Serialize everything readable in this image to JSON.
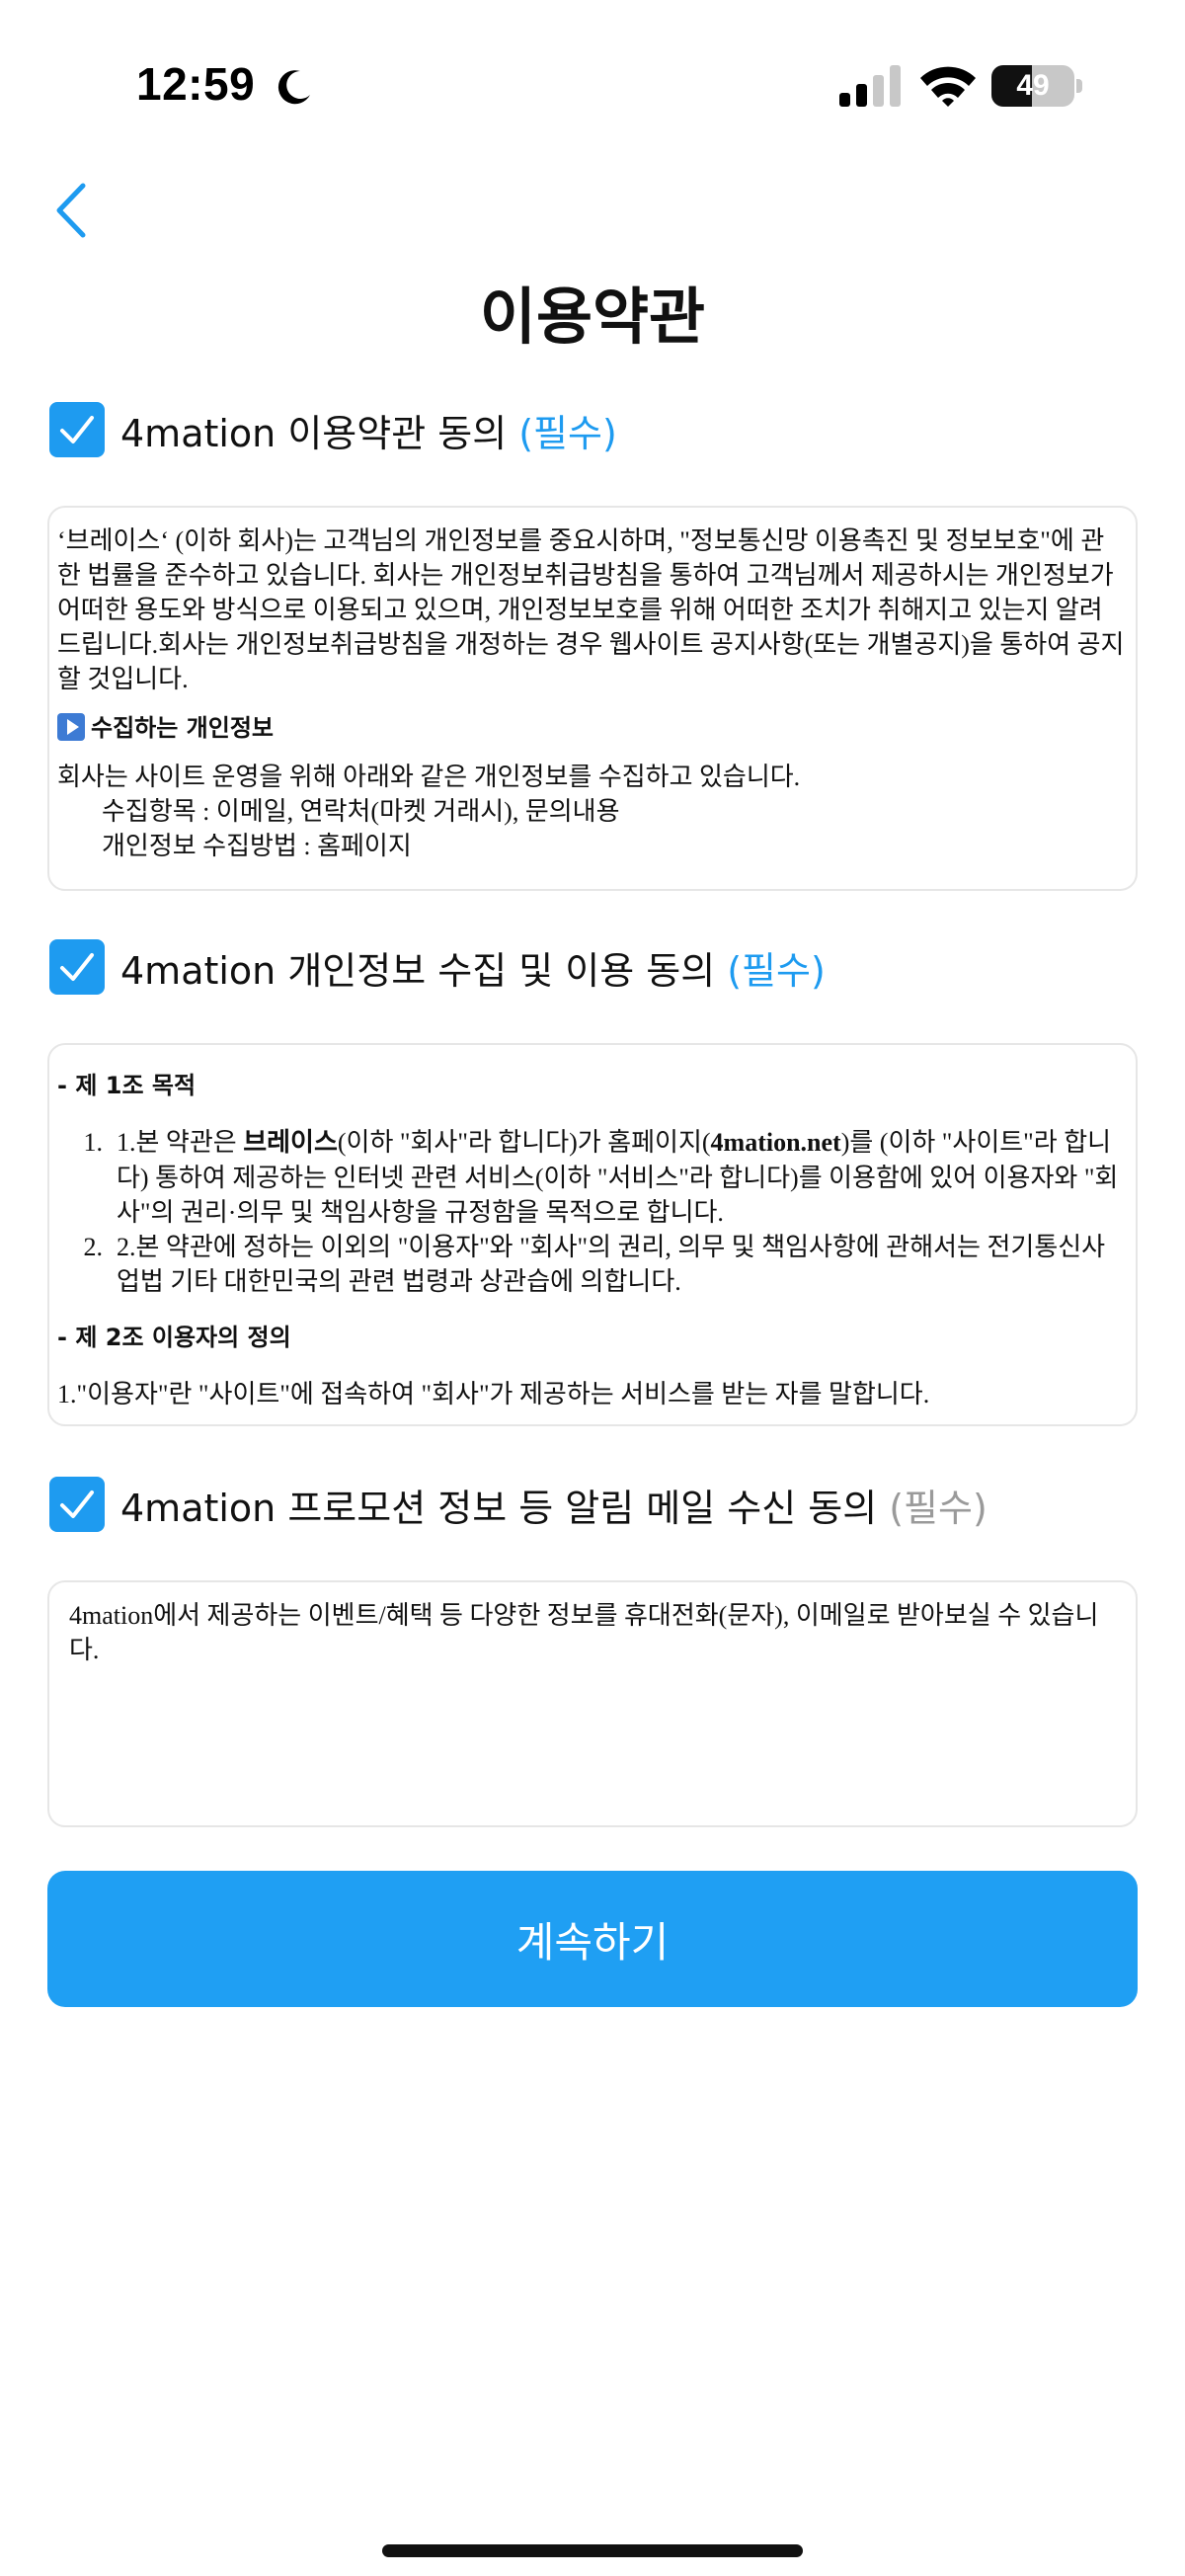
{
  "status_bar": {
    "time": "12:59",
    "battery_level": "49",
    "battery_fraction": 0.49
  },
  "header": {
    "title": "이용약관",
    "back_icon": "chevron-left-icon"
  },
  "colors": {
    "accent": "#1e9bf0",
    "button": "#1f9ff3",
    "required_gray": "#9a9a9a"
  },
  "sections": [
    {
      "checked": true,
      "label": "4mation 이용약관 동의",
      "required": "(필수)",
      "content": {
        "intro": "‘브레이스‘ (이하 회사)는 고객님의 개인정보를 중요시하며, \"정보통신망 이용촉진 및 정보보호\"에 관한 법률을 준수하고 있습니다. 회사는 개인정보취급방침을 통하여 고객님께서 제공하시는 개인정보가 어떠한 용도와 방식으로 이용되고 있으며, 개인정보보호를 위해 어떠한 조치가 취해지고 있는지 알려드립니다.회사는 개인정보취급방침을 개정하는 경우 웹사이트 공지사항(또는 개별공지)을 통하여 공지할 것입니다.",
        "heading": "수집하는 개인정보",
        "heading_icon": "play-button-icon",
        "body": "회사는 사이트 운영을 위해 아래와 같은 개인정보를 수집하고 있습니다.",
        "item1": "수집항목 : 이메일, 연락처(마켓 거래시), 문의내용",
        "item2": "개인정보 수집방법 : 홈페이지"
      }
    },
    {
      "checked": true,
      "label": "4mation 개인정보 수집 및 이용 동의",
      "required": "(필수)",
      "content": {
        "heading1": "- 제 1조 목적",
        "item1_num": "1.",
        "item1_a": "1.본 약관은 ",
        "item1_b": "브레이스",
        "item1_c": "(이하 \"회사\"라 합니다)가 홈페이지(",
        "item1_d": "4mation.net",
        "item1_e": ")를 (이하 \"사이트\"라 합니다) 통하여 제공하는 인터넷 관련 서비스(이하 \"서비스\"라 합니다)를 이용함에 있어 이용자와 \"회사\"의 권리·의무 및 책임사항을 규정함을 목적으로 합니다.",
        "item2_num": "2.",
        "item2": "2.본 약관에 정하는 이외의 \"이용자\"와 \"회사\"의 권리, 의무 및 책임사항에 관해서는 전기통신사업법 기타 대한민국의 관련 법령과 상관습에 의합니다.",
        "heading2": "- 제 2조 이용자의 정의",
        "def1": "1.\"이용자\"란 \"사이트\"에 접속하여 \"회사\"가 제공하는 서비스를 받는 자를 말합니다."
      }
    },
    {
      "checked": true,
      "label": "4mation 프로모션 정보 등 알림 메일 수신 동의",
      "required": "(필수)",
      "content": {
        "body": "4mation에서 제공하는 이벤트/혜택 등 다양한 정보를 휴대전화(문자), 이메일로 받아보실 수 있습니다."
      }
    }
  ],
  "continue_button": {
    "label": "계속하기"
  }
}
